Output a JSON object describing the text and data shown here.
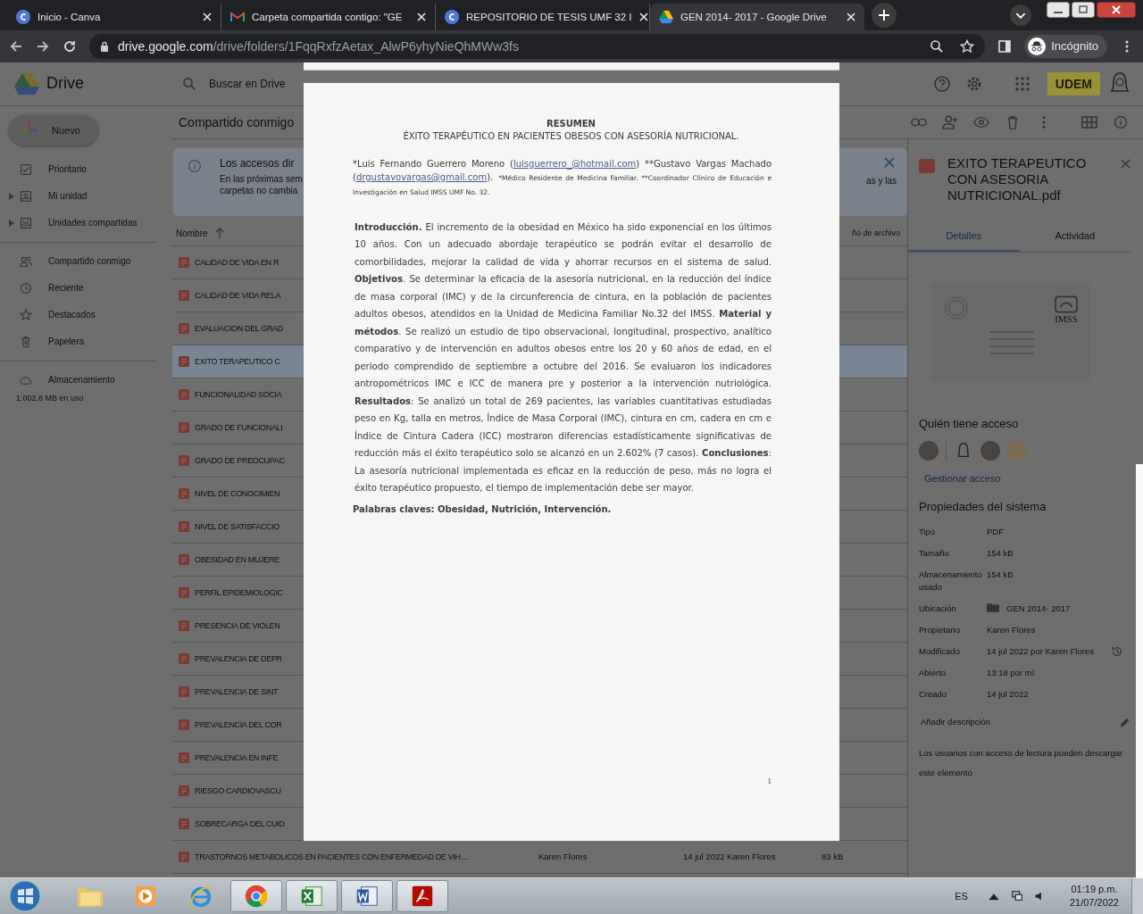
{
  "browser": {
    "tabs": [
      {
        "title": "Inicio - Canva",
        "selected": false
      },
      {
        "title": "Carpeta compartida contigo: \"GE",
        "selected": false
      },
      {
        "title": "REPOSITORIO DE TESIS UMF 32 I",
        "selected": false
      },
      {
        "title": "GEN 2014- 2017 - Google Drive",
        "selected": true
      }
    ],
    "url_host": "drive.google.com",
    "url_path": "/drive/folders/1FqqRxfzAetax_AlwP6yhyNieQhMWw3fs",
    "profile": "Incógnito"
  },
  "drive": {
    "logo": "Drive",
    "search_placeholder": "Buscar en Drive",
    "account_badge": "UDEM",
    "new_button": "Nuevo",
    "nav": [
      {
        "label": "Prioritario",
        "expandable": false
      },
      {
        "label": "Mi unidad",
        "expandable": true
      },
      {
        "label": "Unidades compartidas",
        "expandable": true
      },
      {
        "label": "Compartido conmigo",
        "expandable": false
      },
      {
        "label": "Reciente",
        "expandable": false
      },
      {
        "label": "Destacados",
        "expandable": false
      },
      {
        "label": "Papelera",
        "expandable": false
      }
    ],
    "storage": {
      "label": "Almacenamiento",
      "usage": "1.002,8 MB en uso"
    },
    "heading": "Compartido conmigo",
    "banner": {
      "title": "Los accesos dir",
      "line_1": "En las próximas sem",
      "line_2": "carpetas no cambia",
      "fragment": "as y las"
    },
    "columns": {
      "name": "Nombre",
      "size_fragment": "ño de archivo"
    },
    "files": [
      {
        "name": "CALIDAD DE VIDA EN R",
        "selected": false
      },
      {
        "name": "CALIDAD DE VIDA RELA",
        "selected": false
      },
      {
        "name": "EVALUACION DEL GRAD",
        "selected": false
      },
      {
        "name": "EXITO TERAPEUTICO C",
        "selected": true
      },
      {
        "name": "FUNCIONALIDAD SOCIA",
        "selected": false
      },
      {
        "name": "GRADO DE FUNCIONALI",
        "selected": false
      },
      {
        "name": "GRADO DE PREOCUPAC",
        "selected": false
      },
      {
        "name": "NIVEL DE CONOCIMIEN",
        "selected": false
      },
      {
        "name": "NIVEL DE SATISFACCIO",
        "selected": false
      },
      {
        "name": "OBESIDAD EN MUJERE",
        "selected": false
      },
      {
        "name": "PERFIL EPIDEMIOLOGIC",
        "selected": false
      },
      {
        "name": "PRESENCIA DE VIOLEN",
        "selected": false
      },
      {
        "name": "PREVALENCIA DE DEPR",
        "selected": false
      },
      {
        "name": "PREVALENCIA DE SINT",
        "selected": false
      },
      {
        "name": "PREVALENCIA DEL COR",
        "selected": false
      },
      {
        "name": "PREVALENCIA EN INFE",
        "selected": false
      },
      {
        "name": "RIESGO CARDIOVASCU",
        "selected": false
      },
      {
        "name": "SOBRECARGA DEL CUID",
        "selected": false
      },
      {
        "name": "TRASTORNOS METABOLICOS EN PACIENTES CON ENFERMEDAD DE VIH ...",
        "selected": false,
        "owner": "Karen Flores",
        "modified": "14 jul 2022 Karen Flores",
        "size": "83 kB"
      }
    ],
    "details": {
      "title": "EXITO TERAPEUTICO CON ASESORIA NUTRICIONAL.pdf",
      "tabs": [
        {
          "label": "Detalles",
          "selected": true
        },
        {
          "label": "Actividad",
          "selected": false
        }
      ],
      "thumb_logo": "IMSS",
      "access_heading": "Quién tiene acceso",
      "manage": "Gestionar acceso",
      "props_heading": "Propiedades del sistema",
      "props": [
        {
          "key": "Tipo",
          "value": "PDF",
          "kind": "text"
        },
        {
          "key": "Tamaño",
          "value": "154 kB",
          "kind": "text"
        },
        {
          "key": "Almacenamiento usado",
          "value": "154 kB",
          "kind": "text"
        },
        {
          "key": "Ubicación",
          "value": "GEN 2014- 2017",
          "kind": "folder"
        },
        {
          "key": "Propietario",
          "value": "Karen Flores",
          "kind": "text"
        },
        {
          "key": "Modificado",
          "value": "14 jul 2022 por Karen Flores",
          "kind": "history"
        },
        {
          "key": "Abierto",
          "value": "13:18 por mí",
          "kind": "text"
        },
        {
          "key": "Creado",
          "value": "14 jul 2022",
          "kind": "text"
        }
      ],
      "description_placeholder": "Añadir descripción",
      "note": "Los usuarios con acceso de lectura pueden descargar este elemento"
    }
  },
  "document": {
    "heading": "RESUMEN",
    "title": "ÉXITO TERAPÉUTICO EN PACIENTES OBESOS CON ASESORÍA NUTRICIONAL.",
    "authors": [
      {
        "kind": "text",
        "text": "*Luis Fernando Guerrero Moreno ("
      },
      {
        "kind": "link",
        "text": "luisguerrero_@hotmail.com"
      },
      {
        "kind": "text",
        "text": ") **Gustavo Vargas Machado ("
      },
      {
        "kind": "link",
        "text": "drgustavovargas@gmail.com"
      },
      {
        "kind": "text",
        "text": ")."
      },
      {
        "kind": "note",
        "text": "*Médico Residente de Medicina Familiar. **Coordinador Clínico de Educación e Investigación en Salud IMSS UMF No. 32."
      }
    ],
    "abstract": "**Introducción.** El incremento de la obesidad en México ha sido exponencial en los últimos 10 años. Con un adecuado abordaje terapéutico se podrán evitar el desarrollo de comorbilidades, mejorar la calidad de vida y ahorrar recursos en el sistema de salud. **Objetivos**. Se determinar la eficacia de la asesoría nutricional, en la reducción del índice de masa corporal (IMC) y de la circunferencia de cintura, en la población de pacientes adultos obesos, atendidos en la Unidad de Medicina Familiar No.32 del IMSS. **Material y métodos**. Se realizó un estudio de tipo observacional, longitudinal, prospectivo, analítico comparativo y de intervención en adultos obesos entre los 20 y 60 años de edad, en el periodo comprendido de septiembre a octubre del 2016. Se evaluaron los indicadores antropométricos IMC e ICC de manera pre y posterior a la intervención nutriológica. **Resultados**: Se analizó un total de 269 pacientes, las variables cuantitativas estudiadas peso en Kg, talla en metros, Índice de Masa Corporal (IMC), cintura en cm, cadera en cm e Índice de Cintura Cadera (ICC) mostraron diferencias estadísticamente significativas de reducción más el éxito terapéutico solo se alcanzó en un 2.602% (7 casos). **Conclusiones**: La asesoría nutricional implementada es eficaz en la reducción de peso, más no logra el éxito terapéutico propuesto, el tiempo de implementación debe ser mayor.",
    "keywords": "Palabras claves: Obesidad, Nutrición, Intervención.",
    "page_number": "1"
  },
  "taskbar": {
    "apps": [
      {
        "kind": "folder",
        "active": false
      },
      {
        "kind": "media",
        "active": false
      },
      {
        "kind": "ie",
        "active": false
      },
      {
        "kind": "chrome",
        "active": true
      },
      {
        "kind": "excel",
        "active": true
      },
      {
        "kind": "word",
        "active": true
      },
      {
        "kind": "acrobat",
        "active": true
      }
    ],
    "language": "ES",
    "time": "01:19 p.m.",
    "date": "21/07/2022"
  }
}
